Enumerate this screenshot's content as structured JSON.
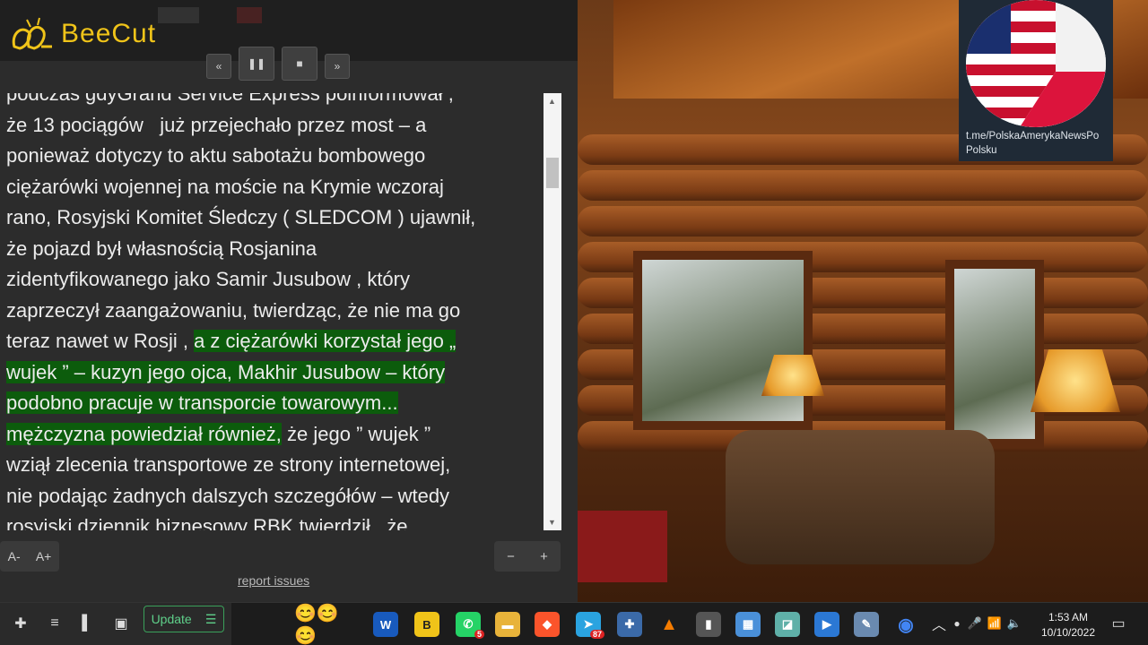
{
  "app": {
    "name": "BeeCut"
  },
  "player": {
    "rewind": "«",
    "pause": "❚❚",
    "stop": "■",
    "forward": "»"
  },
  "reader": {
    "lines": [
      {
        "before": "podczas gdyGrand Service Express poinformował ,",
        "hl": "",
        "after": ""
      },
      {
        "before": "że 13 pociągów   już przejechało przez most – a",
        "hl": "",
        "after": ""
      },
      {
        "before": "ponieważ dotyczy to aktu sabotażu bombowego",
        "hl": "",
        "after": ""
      },
      {
        "before": "ciężarówki wojennej na moście na Krymie wczoraj",
        "hl": "",
        "after": ""
      },
      {
        "before": "rano, Rosyjski Komitet Śledczy ( SLEDCOM ) ujawnił,",
        "hl": "",
        "after": ""
      },
      {
        "before": "że pojazd był własnością Rosjanina",
        "hl": "",
        "after": ""
      },
      {
        "before": "zidentyfikowanego jako Samir Jusubow , który",
        "hl": "",
        "after": ""
      },
      {
        "before": "zaprzeczył zaangażowaniu, twierdząc, że nie ma go",
        "hl": "",
        "after": ""
      },
      {
        "before": "teraz nawet w Rosji , ",
        "hl": "a z ciężarówki korzystał jego „",
        "after": ""
      },
      {
        "before": "",
        "hl": "wujek ” – kuzyn jego ojca, Makhir Jusubow – który",
        "after": ""
      },
      {
        "before": "",
        "hl": "podobno pracuje w transporcie towarowym...",
        "after": ""
      },
      {
        "before": "",
        "hl": "mężczyzna powiedział również,",
        "after": " że jego ” wujek ”"
      },
      {
        "before": "wziął zlecenia transportowe ze strony internetowej,",
        "hl": "",
        "after": ""
      },
      {
        "before": "nie podając żadnych dalszych szczegółów – wtedy",
        "hl": "",
        "after": ""
      },
      {
        "before": "rosyjski dziennik biznesowy RBK twierdził , że",
        "hl": "",
        "after": ""
      }
    ]
  },
  "font_controls": {
    "decrease": "A-",
    "increase": "A+"
  },
  "zoom_controls": {
    "minus": "−",
    "plus": "+"
  },
  "report_link": "report issues",
  "telegram": {
    "channel": "t.me/PolskaAmerykaNewsPo\nPolsku"
  },
  "taskbar": {
    "update_label": "Update",
    "badges": {
      "whatsapp": "5",
      "telegram": "87"
    },
    "time": "1:53 AM",
    "date": "10/10/2022"
  },
  "colors": {
    "highlight": "#0c5c0c",
    "brand": "#f0c419"
  }
}
